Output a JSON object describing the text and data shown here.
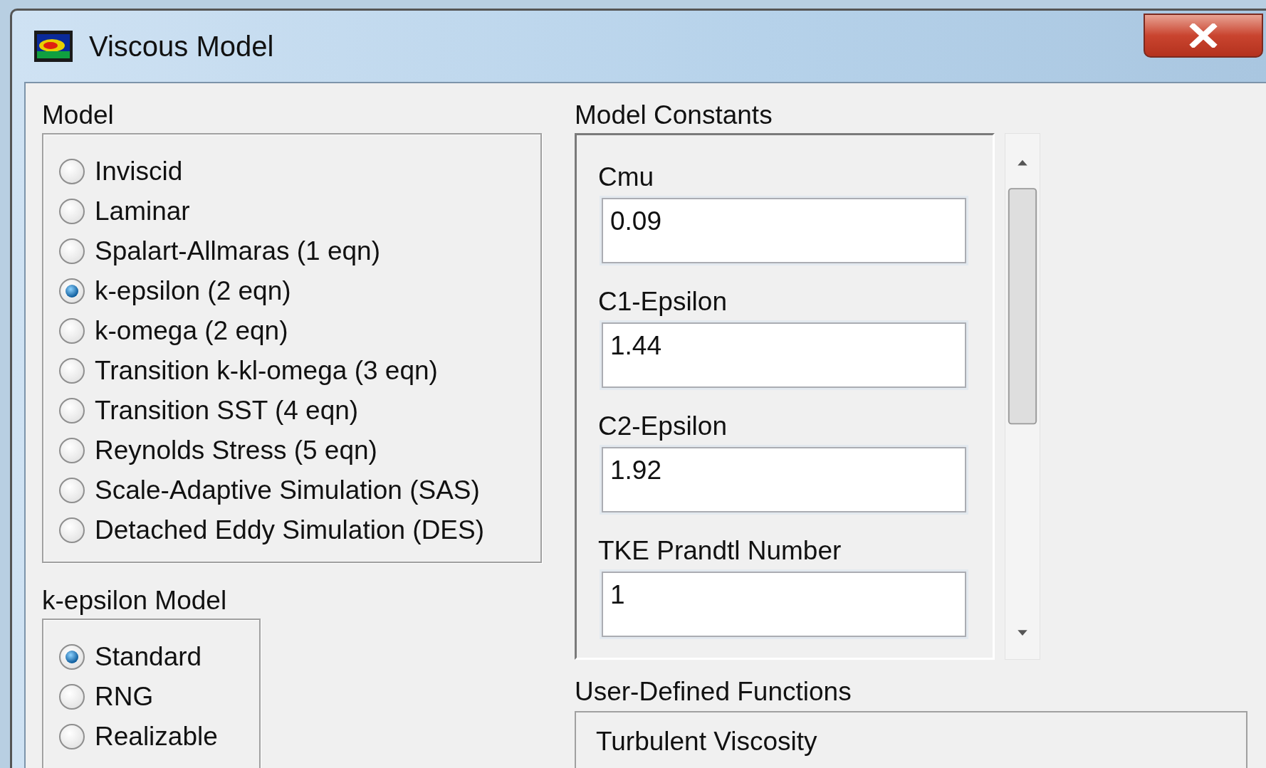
{
  "window": {
    "title": "Viscous Model"
  },
  "model": {
    "label": "Model",
    "options": [
      {
        "label": "Inviscid",
        "selected": false
      },
      {
        "label": "Laminar",
        "selected": false
      },
      {
        "label": "Spalart-Allmaras (1 eqn)",
        "selected": false
      },
      {
        "label": "k-epsilon (2 eqn)",
        "selected": true
      },
      {
        "label": "k-omega (2 eqn)",
        "selected": false
      },
      {
        "label": "Transition k-kl-omega (3 eqn)",
        "selected": false
      },
      {
        "label": "Transition SST (4 eqn)",
        "selected": false
      },
      {
        "label": "Reynolds Stress (5 eqn)",
        "selected": false
      },
      {
        "label": "Scale-Adaptive Simulation (SAS)",
        "selected": false
      },
      {
        "label": "Detached Eddy Simulation (DES)",
        "selected": false
      }
    ]
  },
  "k_epsilon_model": {
    "label": "k-epsilon Model",
    "options": [
      {
        "label": "Standard",
        "selected": true
      },
      {
        "label": "RNG",
        "selected": false
      },
      {
        "label": "Realizable",
        "selected": false
      }
    ]
  },
  "model_constants": {
    "label": "Model Constants",
    "fields": [
      {
        "label": "Cmu",
        "value": "0.09"
      },
      {
        "label": "C1-Epsilon",
        "value": "1.44"
      },
      {
        "label": "C2-Epsilon",
        "value": "1.92"
      },
      {
        "label": "TKE Prandtl Number",
        "value": "1"
      }
    ]
  },
  "user_defined_functions": {
    "label": "User-Defined Functions",
    "fields": [
      {
        "label": "Turbulent Viscosity"
      }
    ]
  }
}
